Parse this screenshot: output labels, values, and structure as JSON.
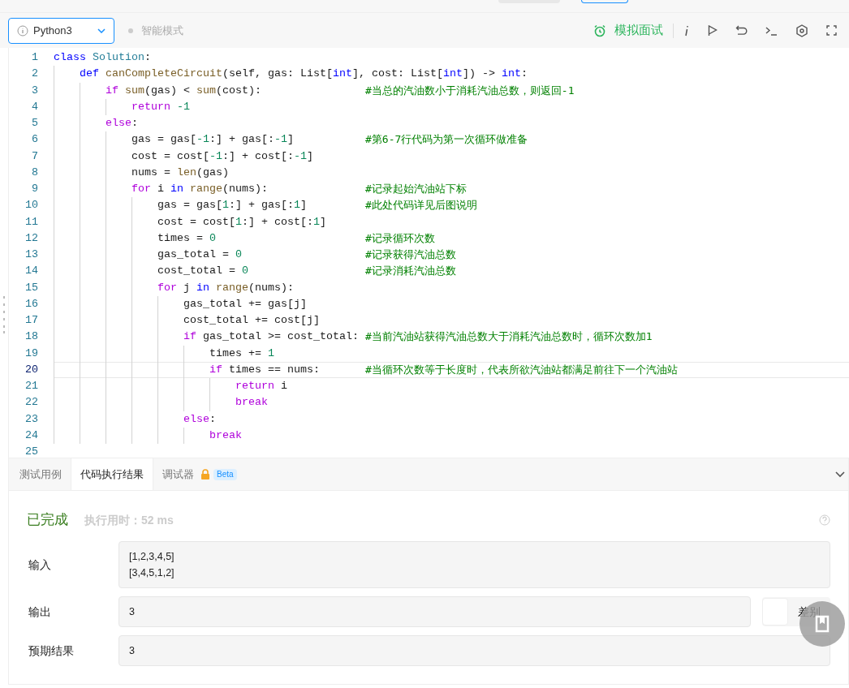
{
  "toolbar": {
    "language": "Python3",
    "mode": "智能模式",
    "interview": "模拟面试"
  },
  "editor": {
    "lines": [
      {
        "number": "1",
        "current": false,
        "tokens": [
          {
            "text": "class ",
            "kind": "keyword"
          },
          {
            "text": "Solution",
            "kind": "class"
          },
          {
            "text": ":",
            "kind": "plain"
          }
        ]
      },
      {
        "number": "2",
        "current": false,
        "tokens": [
          {
            "text": "    def ",
            "kind": "keyword"
          },
          {
            "text": "canCompleteCircuit",
            "kind": "function"
          },
          {
            "text": "(self, gas: List[",
            "kind": "plain"
          },
          {
            "text": "int",
            "kind": "keyword"
          },
          {
            "text": "], cost: List[",
            "kind": "plain"
          },
          {
            "text": "int",
            "kind": "keyword"
          },
          {
            "text": "]) -> ",
            "kind": "plain"
          },
          {
            "text": "int",
            "kind": "keyword"
          },
          {
            "text": ":",
            "kind": "plain"
          }
        ]
      },
      {
        "number": "3",
        "current": false,
        "tokens": [
          {
            "text": "        if ",
            "kind": "control"
          },
          {
            "text": "sum",
            "kind": "function"
          },
          {
            "text": "(gas) < ",
            "kind": "plain"
          },
          {
            "text": "sum",
            "kind": "function"
          },
          {
            "text": "(cost):",
            "kind": "plain"
          }
        ],
        "comment": "#当总的汽油数小于消耗汽油总数，则返回-1"
      },
      {
        "number": "4",
        "current": false,
        "tokens": [
          {
            "text": "            return ",
            "kind": "control"
          },
          {
            "text": "-1",
            "kind": "number"
          }
        ]
      },
      {
        "number": "5",
        "current": false,
        "tokens": [
          {
            "text": "        else",
            "kind": "control"
          },
          {
            "text": ":",
            "kind": "plain"
          }
        ]
      },
      {
        "number": "6",
        "current": false,
        "tokens": [
          {
            "text": "            gas = gas[",
            "kind": "plain"
          },
          {
            "text": "-1",
            "kind": "number"
          },
          {
            "text": ":] + gas[:",
            "kind": "plain"
          },
          {
            "text": "-1",
            "kind": "number"
          },
          {
            "text": "]",
            "kind": "plain"
          }
        ],
        "comment": "#第6-7行代码为第一次循环做准备"
      },
      {
        "number": "7",
        "current": false,
        "tokens": [
          {
            "text": "            cost = cost[",
            "kind": "plain"
          },
          {
            "text": "-1",
            "kind": "number"
          },
          {
            "text": ":] + cost[:",
            "kind": "plain"
          },
          {
            "text": "-1",
            "kind": "number"
          },
          {
            "text": "]",
            "kind": "plain"
          }
        ]
      },
      {
        "number": "8",
        "current": false,
        "tokens": [
          {
            "text": "            nums = ",
            "kind": "plain"
          },
          {
            "text": "len",
            "kind": "function"
          },
          {
            "text": "(gas)",
            "kind": "plain"
          }
        ]
      },
      {
        "number": "9",
        "current": false,
        "tokens": [
          {
            "text": "            for",
            "kind": "control"
          },
          {
            "text": " i ",
            "kind": "plain"
          },
          {
            "text": "in ",
            "kind": "keyword"
          },
          {
            "text": "range",
            "kind": "function"
          },
          {
            "text": "(nums):",
            "kind": "plain"
          }
        ],
        "comment": "#记录起始汽油站下标"
      },
      {
        "number": "10",
        "current": false,
        "tokens": [
          {
            "text": "                gas = gas[",
            "kind": "plain"
          },
          {
            "text": "1",
            "kind": "number"
          },
          {
            "text": ":] + gas[:",
            "kind": "plain"
          },
          {
            "text": "1",
            "kind": "number"
          },
          {
            "text": "]",
            "kind": "plain"
          }
        ],
        "comment": "#此处代码详见后图说明"
      },
      {
        "number": "11",
        "current": false,
        "tokens": [
          {
            "text": "                cost = cost[",
            "kind": "plain"
          },
          {
            "text": "1",
            "kind": "number"
          },
          {
            "text": ":] + cost[:",
            "kind": "plain"
          },
          {
            "text": "1",
            "kind": "number"
          },
          {
            "text": "]",
            "kind": "plain"
          }
        ]
      },
      {
        "number": "12",
        "current": false,
        "tokens": [
          {
            "text": "                times = ",
            "kind": "plain"
          },
          {
            "text": "0",
            "kind": "number"
          }
        ],
        "comment": "#记录循环次数"
      },
      {
        "number": "13",
        "current": false,
        "tokens": [
          {
            "text": "                gas_total = ",
            "kind": "plain"
          },
          {
            "text": "0",
            "kind": "number"
          }
        ],
        "comment": "#记录获得汽油总数"
      },
      {
        "number": "14",
        "current": false,
        "tokens": [
          {
            "text": "                cost_total = ",
            "kind": "plain"
          },
          {
            "text": "0",
            "kind": "number"
          }
        ],
        "comment": "#记录消耗汽油总数"
      },
      {
        "number": "15",
        "current": false,
        "tokens": [
          {
            "text": "                for",
            "kind": "control"
          },
          {
            "text": " j ",
            "kind": "plain"
          },
          {
            "text": "in ",
            "kind": "keyword"
          },
          {
            "text": "range",
            "kind": "function"
          },
          {
            "text": "(nums):",
            "kind": "plain"
          }
        ]
      },
      {
        "number": "16",
        "current": false,
        "tokens": [
          {
            "text": "                    gas_total += gas[j]",
            "kind": "plain"
          }
        ]
      },
      {
        "number": "17",
        "current": false,
        "tokens": [
          {
            "text": "                    cost_total += cost[j]",
            "kind": "plain"
          }
        ]
      },
      {
        "number": "18",
        "current": false,
        "tokens": [
          {
            "text": "                    if",
            "kind": "control"
          },
          {
            "text": " gas_total >= cost_total:",
            "kind": "plain"
          }
        ],
        "comment": "#当前汽油站获得汽油总数大于消耗汽油总数时，循环次数加1"
      },
      {
        "number": "19",
        "current": false,
        "tokens": [
          {
            "text": "                        times += ",
            "kind": "plain"
          },
          {
            "text": "1",
            "kind": "number"
          }
        ]
      },
      {
        "number": "20",
        "current": true,
        "tokens": [
          {
            "text": "                        if",
            "kind": "control"
          },
          {
            "text": " times == nums:",
            "kind": "plain"
          }
        ],
        "comment": "#当循环次数等于长度时，代表所欲汽油站都满足前往下一个汽油站"
      },
      {
        "number": "21",
        "current": false,
        "tokens": [
          {
            "text": "                            return",
            "kind": "control"
          },
          {
            "text": " i",
            "kind": "plain"
          }
        ]
      },
      {
        "number": "22",
        "current": false,
        "tokens": [
          {
            "text": "                            break",
            "kind": "control"
          }
        ]
      },
      {
        "number": "23",
        "current": false,
        "tokens": [
          {
            "text": "                    else",
            "kind": "control"
          },
          {
            "text": ":",
            "kind": "plain"
          }
        ]
      },
      {
        "number": "24",
        "current": false,
        "tokens": [
          {
            "text": "                        break",
            "kind": "control"
          }
        ]
      },
      {
        "number": "25",
        "current": false
      }
    ]
  },
  "panel": {
    "tabs": [
      {
        "label": "测试用例",
        "selected": false,
        "kind": "plain"
      },
      {
        "label": "代码执行结果",
        "selected": true,
        "kind": "plain"
      },
      {
        "label": "调试器",
        "selected": false,
        "kind": "beta",
        "badge": "Beta"
      }
    ],
    "status": "已完成",
    "runtime": "执行用时：52 ms",
    "rows": [
      {
        "label": "输入",
        "lines": [
          "[1,2,3,4,5]",
          "[3,4,5,1,2]"
        ]
      },
      {
        "label": "输出",
        "lines": [
          "3"
        ],
        "diff": "差别"
      },
      {
        "label": "预期结果",
        "lines": [
          "3"
        ]
      }
    ]
  }
}
